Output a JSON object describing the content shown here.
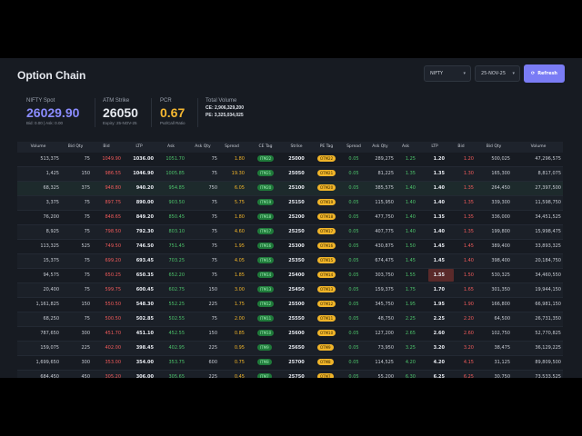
{
  "title": "Option Chain",
  "controls": {
    "symbol": "NIFTY",
    "expiry": "25-NOV-25",
    "refresh_label": "Refresh"
  },
  "stats": {
    "spot": {
      "label": "NIFTY Spot",
      "value": "26029.90",
      "sub": "Bid: 0.00 | Ask: 0.00"
    },
    "atm": {
      "label": "ATM Strike",
      "value": "26050",
      "sub": "Expiry: 25-NOV-25"
    },
    "pcr": {
      "label": "PCR",
      "value": "0.67",
      "sub": "Put/Call Ratio"
    },
    "volume": {
      "label": "Total Volume",
      "ce": "CE: 2,906,329,200",
      "pe": "PE: 3,325,034,025"
    }
  },
  "colors": {
    "accent": "#7a7cf5",
    "spot": "#8b8cff",
    "pcr": "#f5b731",
    "green": "#4cc26a",
    "red": "#f05a5a",
    "yellow": "#f0b429"
  },
  "headers": [
    "Volume",
    "Bid Qty",
    "Bid",
    "LTP",
    "Ask",
    "Ask Qty",
    "Spread",
    "CE Tag",
    "Strike",
    "PE Tag",
    "Spread",
    "Ask Qty",
    "Ask",
    "LTP",
    "Bid",
    "Bid Qty",
    "Volume"
  ],
  "rows": [
    [
      "513,375",
      "75",
      "1049.90",
      "1036.00",
      "1051.70",
      "75",
      "1.80",
      "ITM22",
      "25000",
      "OTM22",
      "0.05",
      "289,275",
      "1.25",
      "1.20",
      "1.20",
      "500,025",
      "47,296,575"
    ],
    [
      "1,425",
      "150",
      "986.55",
      "1046.90",
      "1005.85",
      "75",
      "19.30",
      "ITM21",
      "25050",
      "OTM21",
      "0.05",
      "81,225",
      "1.35",
      "1.35",
      "1.30",
      "165,300",
      "8,817,075"
    ],
    [
      "68,325",
      "375",
      "948.80",
      "940.20",
      "954.85",
      "750",
      "6.05",
      "ITM20",
      "25100",
      "OTM20",
      "0.05",
      "385,575",
      "1.40",
      "1.40",
      "1.35",
      "264,450",
      "27,397,500"
    ],
    [
      "3,375",
      "75",
      "897.75",
      "890.00",
      "903.50",
      "75",
      "5.75",
      "ITM19",
      "25150",
      "OTM19",
      "0.05",
      "115,950",
      "1.40",
      "1.40",
      "1.35",
      "339,300",
      "11,598,750"
    ],
    [
      "76,200",
      "75",
      "848.65",
      "849.20",
      "850.45",
      "75",
      "1.80",
      "ITM18",
      "25200",
      "OTM18",
      "0.05",
      "477,750",
      "1.40",
      "1.35",
      "1.35",
      "336,000",
      "34,451,525"
    ],
    [
      "8,925",
      "75",
      "798.50",
      "792.30",
      "803.10",
      "75",
      "4.60",
      "ITM17",
      "25250",
      "OTM17",
      "0.05",
      "407,775",
      "1.40",
      "1.40",
      "1.35",
      "199,800",
      "15,998,475"
    ],
    [
      "113,325",
      "525",
      "749.50",
      "746.50",
      "751.45",
      "75",
      "1.95",
      "ITM16",
      "25300",
      "OTM16",
      "0.05",
      "430,875",
      "1.50",
      "1.45",
      "1.45",
      "389,400",
      "33,893,325"
    ],
    [
      "15,375",
      "75",
      "699.20",
      "693.45",
      "703.25",
      "75",
      "4.05",
      "ITM15",
      "25350",
      "OTM15",
      "0.05",
      "674,475",
      "1.45",
      "1.45",
      "1.40",
      "398,400",
      "20,184,750"
    ],
    [
      "94,575",
      "75",
      "650.25",
      "650.35",
      "652.20",
      "75",
      "1.85",
      "ITM14",
      "25400",
      "OTM14",
      "0.05",
      "303,750",
      "1.55",
      "1.55",
      "1.50",
      "530,325",
      "34,460,550"
    ],
    [
      "20,400",
      "75",
      "599.75",
      "600.45",
      "602.75",
      "150",
      "3.00",
      "ITM13",
      "25450",
      "OTM13",
      "0.05",
      "159,375",
      "1.75",
      "1.70",
      "1.65",
      "301,350",
      "19,944,150"
    ],
    [
      "1,161,825",
      "150",
      "550.50",
      "548.30",
      "552.25",
      "225",
      "1.75",
      "ITM12",
      "25500",
      "OTM12",
      "0.05",
      "345,750",
      "1.95",
      "1.95",
      "1.90",
      "166,800",
      "66,981,150"
    ],
    [
      "68,250",
      "75",
      "500.50",
      "502.85",
      "502.55",
      "75",
      "2.00",
      "ITM11",
      "25550",
      "OTM11",
      "0.05",
      "48,750",
      "2.25",
      "2.25",
      "2.20",
      "64,500",
      "26,731,350"
    ],
    [
      "787,650",
      "300",
      "451.70",
      "451.10",
      "452.55",
      "150",
      "0.85",
      "ITM10",
      "25600",
      "OTM10",
      "0.05",
      "127,200",
      "2.65",
      "2.60",
      "2.60",
      "102,750",
      "52,770,825"
    ],
    [
      "159,075",
      "225",
      "402.00",
      "398.45",
      "402.95",
      "225",
      "0.95",
      "ITM9",
      "25650",
      "OTM9",
      "0.05",
      "73,950",
      "3.25",
      "3.20",
      "3.20",
      "38,475",
      "36,129,225"
    ],
    [
      "1,699,650",
      "300",
      "353.00",
      "354.00",
      "353.75",
      "600",
      "0.75",
      "ITM8",
      "25700",
      "OTM8",
      "0.05",
      "114,525",
      "4.20",
      "4.20",
      "4.15",
      "31,125",
      "89,809,500"
    ],
    [
      "684,450",
      "450",
      "305.20",
      "306.00",
      "305.65",
      "225",
      "0.45",
      "ITM7",
      "25750",
      "OTM7",
      "0.05",
      "55,200",
      "6.30",
      "6.25",
      "6.25",
      "30,750",
      "73,533,525"
    ],
    [
      "8,873,700",
      "450",
      "258.90",
      "259.55",
      "259.45",
      "300",
      "0.55",
      "ITM6",
      "25800",
      "OTM6",
      "0.05",
      "32,850",
      "9.60",
      "9.55",
      "9.55",
      "21,675",
      "137,047,425"
    ]
  ]
}
